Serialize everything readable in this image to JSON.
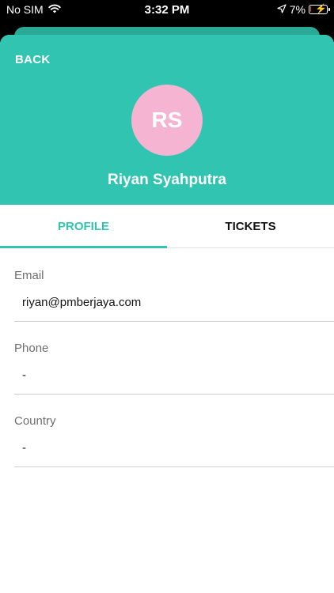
{
  "status_bar": {
    "carrier": "No SIM",
    "time": "3:32 PM",
    "battery": "7%",
    "battery_level": 0.07,
    "icons": [
      "wifi-icon",
      "location-arrow-icon",
      "battery-charging-icon"
    ]
  },
  "header": {
    "back_label": "BACK",
    "avatar_initials": "RS",
    "user_name": "Riyan Syahputra"
  },
  "tabs": [
    {
      "label": "PROFILE",
      "active": true
    },
    {
      "label": "TICKETS",
      "active": false
    }
  ],
  "fields": [
    {
      "label": "Email",
      "value": "riyan@pmberjaya.com"
    },
    {
      "label": "Phone",
      "value": "-"
    },
    {
      "label": "Country",
      "value": "-"
    }
  ],
  "colors": {
    "accent": "#31c4b1",
    "avatar": "#f5b5d2",
    "battery_low": "#ff3b30"
  }
}
